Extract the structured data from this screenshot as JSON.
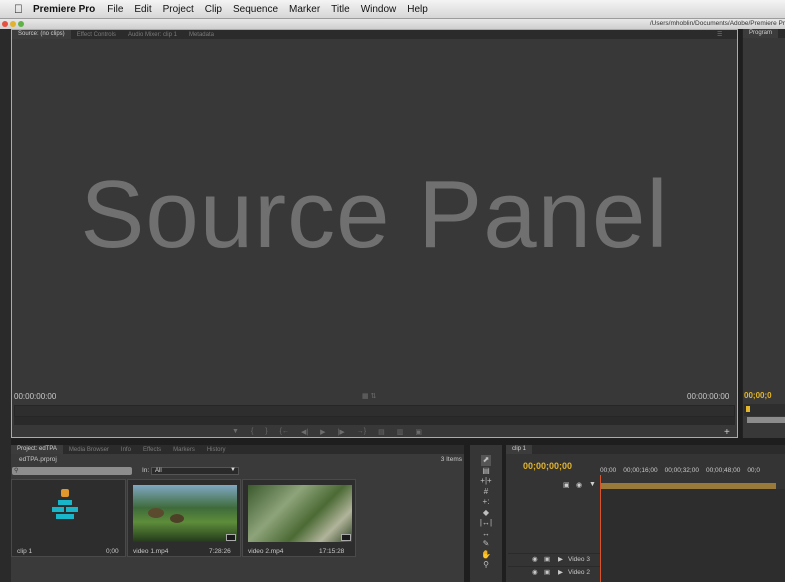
{
  "menubar": {
    "apple": "",
    "app_name": "Premiere Pro",
    "items": [
      "File",
      "Edit",
      "Project",
      "Clip",
      "Sequence",
      "Marker",
      "Title",
      "Window",
      "Help"
    ]
  },
  "titlebar": {
    "path": "/Users/mhoblin/Documents/Adobe/Premiere Pr"
  },
  "source_panel": {
    "tabs": [
      "Source: (no clips)",
      "Effect Controls",
      "Audio Mixer: clip 1",
      "Metadata"
    ],
    "overlay_text": "Source Panel",
    "tc_left": "00:00:00:00",
    "tc_right": "00:00:00:00"
  },
  "program_panel": {
    "tab": "Program",
    "tc": "00;00;0"
  },
  "project_panel": {
    "tabs": [
      "Project: edTPA",
      "Media Browser",
      "Info",
      "Effects",
      "Markers",
      "History"
    ],
    "file": "edTPA.prproj",
    "item_count": "3 Items",
    "in_label": "In:",
    "in_value": "All",
    "search_placeholder": "",
    "items": [
      {
        "name": "clip 1",
        "duration": "0;00"
      },
      {
        "name": "video 1.mp4",
        "duration": "7:28:26"
      },
      {
        "name": "video 2.mp4",
        "duration": "17:15:28"
      }
    ]
  },
  "timeline": {
    "tab": "clip 1",
    "tc": "00;00;00;00",
    "ruler": [
      "00;00",
      "00;00;16;00",
      "00;00;32;00",
      "00;00;48;00",
      "00;0"
    ],
    "tracks": [
      "Video 3",
      "Video 2"
    ]
  },
  "colors": {
    "accent": "#e4a531",
    "tc_yellow": "#e3b52a",
    "playhead": "#d9542b"
  }
}
